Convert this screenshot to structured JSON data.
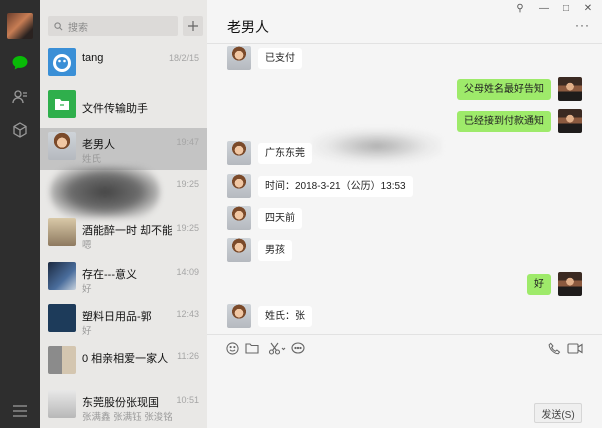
{
  "sidebar_rail": {
    "icons": [
      "chat-icon",
      "contacts-icon",
      "favorites-cube-icon",
      "menu-icon"
    ],
    "accent": "#09bb07"
  },
  "chat_list": {
    "search_placeholder": "搜索",
    "items": [
      {
        "name": "tang",
        "time": "18/2/15",
        "preview": ""
      },
      {
        "name": "文件传输助手",
        "time": "",
        "preview": ""
      },
      {
        "name": "老男人",
        "time": "19:47",
        "preview": "姓氏"
      },
      {
        "name": "",
        "time": "19:25",
        "preview": ""
      },
      {
        "name": "酒能醉一时 却不能...",
        "time": "19:25",
        "preview": "嗯"
      },
      {
        "name": "存在---意义",
        "time": "14:09",
        "preview": "好"
      },
      {
        "name": "塑料日用品-郭",
        "time": "12:43",
        "preview": "好"
      },
      {
        "name": "0 相亲相爱一家人",
        "time": "11:26",
        "preview": ""
      },
      {
        "name": "东莞股份张现国",
        "time": "10:51",
        "preview": "张满鑫 张满钰 张浚铭"
      }
    ]
  },
  "chat": {
    "title": "老男人",
    "window_controls": [
      "⚲",
      "—",
      "□",
      "✕"
    ],
    "more": "···",
    "messages": [
      {
        "side": "in",
        "text": "已支付"
      },
      {
        "side": "out",
        "text": "父母姓名最好告知"
      },
      {
        "side": "out",
        "text": "已经接到付款通知"
      },
      {
        "side": "in",
        "text": "广东东莞"
      },
      {
        "side": "in",
        "text": "时间：2018-3-21（公历）13:53"
      },
      {
        "side": "in",
        "text": "四天前"
      },
      {
        "side": "in",
        "text": "男孩"
      },
      {
        "side": "out",
        "text": "好"
      },
      {
        "side": "in",
        "text": "姓氏：张"
      }
    ],
    "toolbar_icons": [
      "emoji-icon",
      "folder-icon",
      "scissors-icon",
      "chat-bubble-icon",
      "phone-icon",
      "video-icon"
    ],
    "send_label": "发送(S)",
    "bubble_out_color": "#9eea6a"
  }
}
